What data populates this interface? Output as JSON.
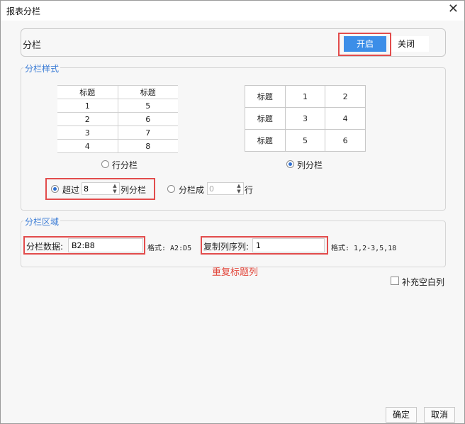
{
  "window": {
    "title": "报表分栏",
    "close_glyph": "✕"
  },
  "switch": {
    "label": "分栏",
    "on_label": "开启",
    "off_label": "关闭",
    "active": "on"
  },
  "style_section": {
    "title": "分栏样式",
    "row_preview": {
      "header": [
        "标题",
        "标题"
      ],
      "rows": [
        [
          "1",
          "5"
        ],
        [
          "2",
          "6"
        ],
        [
          "3",
          "7"
        ],
        [
          "4",
          "8"
        ]
      ]
    },
    "col_preview": {
      "rows": [
        [
          "标题",
          "1",
          "2"
        ],
        [
          "标题",
          "3",
          "4"
        ],
        [
          "标题",
          "5",
          "6"
        ]
      ]
    },
    "row_option_label": "行分栏",
    "col_option_label": "列分栏",
    "selected_layout": "col",
    "exceed_label": "超过",
    "exceed_value": "8",
    "exceed_suffix": "列分栏",
    "split_label": "分栏成",
    "split_value": "0",
    "split_suffix": "行",
    "selected_mode": "exceed"
  },
  "area_section": {
    "title": "分栏区域",
    "data_label": "分栏数据:",
    "data_value": "B2:B8",
    "data_format": "格式: A2:D5",
    "repeat_label": "复制列序列:",
    "repeat_value": "1",
    "repeat_format": "格式: 1,2-3,5,18",
    "annotation": "重复标题列"
  },
  "options": {
    "fill_blank_label": "补充空白列",
    "fill_blank_checked": false
  },
  "footer": {
    "ok_label": "确定",
    "cancel_label": "取消"
  },
  "colors": {
    "accent": "#3c8ee8",
    "highlight": "#e24c4c",
    "section_title": "#3a7bd5"
  }
}
